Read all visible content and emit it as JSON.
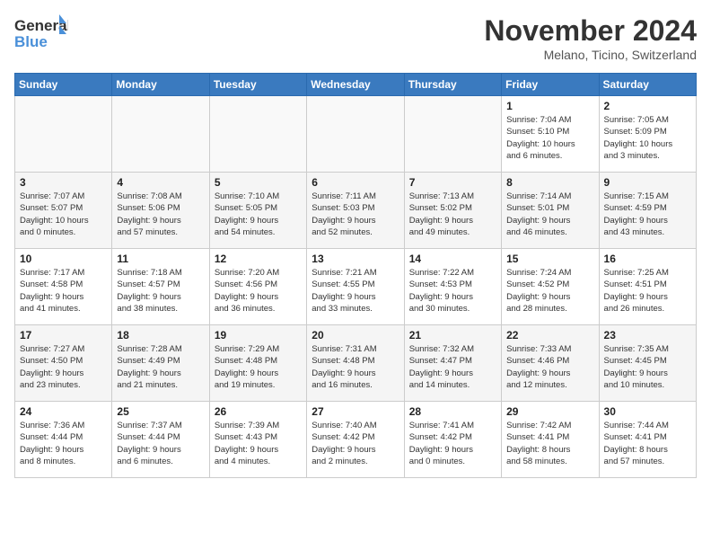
{
  "logo": {
    "line1": "General",
    "line2": "Blue"
  },
  "title": "November 2024",
  "subtitle": "Melano, Ticino, Switzerland",
  "headers": [
    "Sunday",
    "Monday",
    "Tuesday",
    "Wednesday",
    "Thursday",
    "Friday",
    "Saturday"
  ],
  "weeks": [
    [
      {
        "day": "",
        "info": ""
      },
      {
        "day": "",
        "info": ""
      },
      {
        "day": "",
        "info": ""
      },
      {
        "day": "",
        "info": ""
      },
      {
        "day": "",
        "info": ""
      },
      {
        "day": "1",
        "info": "Sunrise: 7:04 AM\nSunset: 5:10 PM\nDaylight: 10 hours\nand 6 minutes."
      },
      {
        "day": "2",
        "info": "Sunrise: 7:05 AM\nSunset: 5:09 PM\nDaylight: 10 hours\nand 3 minutes."
      }
    ],
    [
      {
        "day": "3",
        "info": "Sunrise: 7:07 AM\nSunset: 5:07 PM\nDaylight: 10 hours\nand 0 minutes."
      },
      {
        "day": "4",
        "info": "Sunrise: 7:08 AM\nSunset: 5:06 PM\nDaylight: 9 hours\nand 57 minutes."
      },
      {
        "day": "5",
        "info": "Sunrise: 7:10 AM\nSunset: 5:05 PM\nDaylight: 9 hours\nand 54 minutes."
      },
      {
        "day": "6",
        "info": "Sunrise: 7:11 AM\nSunset: 5:03 PM\nDaylight: 9 hours\nand 52 minutes."
      },
      {
        "day": "7",
        "info": "Sunrise: 7:13 AM\nSunset: 5:02 PM\nDaylight: 9 hours\nand 49 minutes."
      },
      {
        "day": "8",
        "info": "Sunrise: 7:14 AM\nSunset: 5:01 PM\nDaylight: 9 hours\nand 46 minutes."
      },
      {
        "day": "9",
        "info": "Sunrise: 7:15 AM\nSunset: 4:59 PM\nDaylight: 9 hours\nand 43 minutes."
      }
    ],
    [
      {
        "day": "10",
        "info": "Sunrise: 7:17 AM\nSunset: 4:58 PM\nDaylight: 9 hours\nand 41 minutes."
      },
      {
        "day": "11",
        "info": "Sunrise: 7:18 AM\nSunset: 4:57 PM\nDaylight: 9 hours\nand 38 minutes."
      },
      {
        "day": "12",
        "info": "Sunrise: 7:20 AM\nSunset: 4:56 PM\nDaylight: 9 hours\nand 36 minutes."
      },
      {
        "day": "13",
        "info": "Sunrise: 7:21 AM\nSunset: 4:55 PM\nDaylight: 9 hours\nand 33 minutes."
      },
      {
        "day": "14",
        "info": "Sunrise: 7:22 AM\nSunset: 4:53 PM\nDaylight: 9 hours\nand 30 minutes."
      },
      {
        "day": "15",
        "info": "Sunrise: 7:24 AM\nSunset: 4:52 PM\nDaylight: 9 hours\nand 28 minutes."
      },
      {
        "day": "16",
        "info": "Sunrise: 7:25 AM\nSunset: 4:51 PM\nDaylight: 9 hours\nand 26 minutes."
      }
    ],
    [
      {
        "day": "17",
        "info": "Sunrise: 7:27 AM\nSunset: 4:50 PM\nDaylight: 9 hours\nand 23 minutes."
      },
      {
        "day": "18",
        "info": "Sunrise: 7:28 AM\nSunset: 4:49 PM\nDaylight: 9 hours\nand 21 minutes."
      },
      {
        "day": "19",
        "info": "Sunrise: 7:29 AM\nSunset: 4:48 PM\nDaylight: 9 hours\nand 19 minutes."
      },
      {
        "day": "20",
        "info": "Sunrise: 7:31 AM\nSunset: 4:48 PM\nDaylight: 9 hours\nand 16 minutes."
      },
      {
        "day": "21",
        "info": "Sunrise: 7:32 AM\nSunset: 4:47 PM\nDaylight: 9 hours\nand 14 minutes."
      },
      {
        "day": "22",
        "info": "Sunrise: 7:33 AM\nSunset: 4:46 PM\nDaylight: 9 hours\nand 12 minutes."
      },
      {
        "day": "23",
        "info": "Sunrise: 7:35 AM\nSunset: 4:45 PM\nDaylight: 9 hours\nand 10 minutes."
      }
    ],
    [
      {
        "day": "24",
        "info": "Sunrise: 7:36 AM\nSunset: 4:44 PM\nDaylight: 9 hours\nand 8 minutes."
      },
      {
        "day": "25",
        "info": "Sunrise: 7:37 AM\nSunset: 4:44 PM\nDaylight: 9 hours\nand 6 minutes."
      },
      {
        "day": "26",
        "info": "Sunrise: 7:39 AM\nSunset: 4:43 PM\nDaylight: 9 hours\nand 4 minutes."
      },
      {
        "day": "27",
        "info": "Sunrise: 7:40 AM\nSunset: 4:42 PM\nDaylight: 9 hours\nand 2 minutes."
      },
      {
        "day": "28",
        "info": "Sunrise: 7:41 AM\nSunset: 4:42 PM\nDaylight: 9 hours\nand 0 minutes."
      },
      {
        "day": "29",
        "info": "Sunrise: 7:42 AM\nSunset: 4:41 PM\nDaylight: 8 hours\nand 58 minutes."
      },
      {
        "day": "30",
        "info": "Sunrise: 7:44 AM\nSunset: 4:41 PM\nDaylight: 8 hours\nand 57 minutes."
      }
    ]
  ]
}
